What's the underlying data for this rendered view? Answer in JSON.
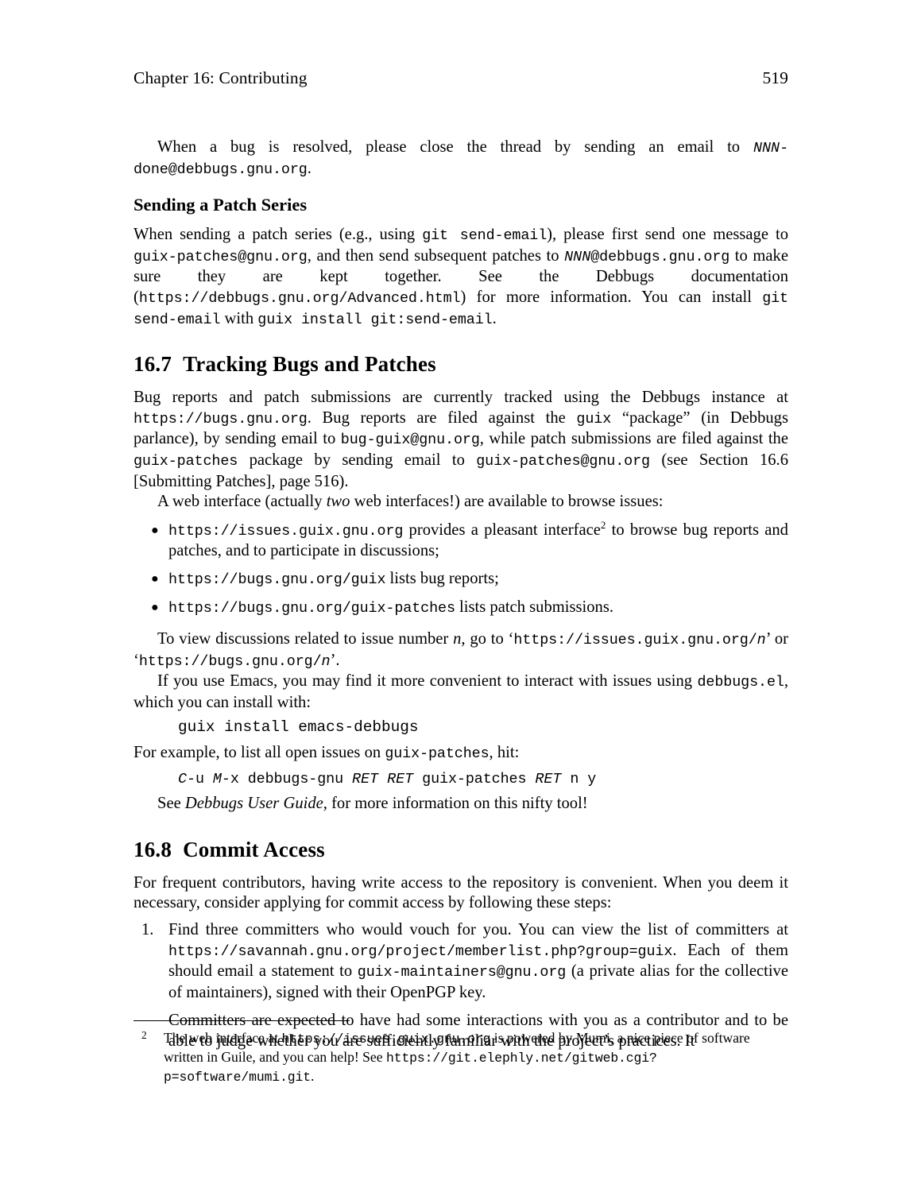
{
  "page": {
    "running_head": "Chapter 16:  Contributing",
    "page_number": "519"
  },
  "intro_paragraph": {
    "text_before": "When a bug is resolved, please close the thread by sending an email to ",
    "email_italic": "NNN",
    "email_rest": "-done@debbugs.gnu.org",
    "text_after": "."
  },
  "patch_series": {
    "heading": "Sending a Patch Series",
    "p1_a": "When sending a patch series (e.g., using ",
    "p1_code1": "git send-email",
    "p1_b": "), please first send one message to ",
    "p1_code2": "guix-patches@gnu.org",
    "p1_c": ", and then send subsequent patches to ",
    "p1_code3_italic": "NNN",
    "p1_code3_rest": "@debbugs.gnu.org",
    "p1_d": " to make sure they are kept together. See the Debbugs documentation (",
    "p1_url": "https://debbugs.gnu.org/Advanced.html",
    "p1_e": ") for more information. You can install ",
    "p1_code4": "git send-email",
    "p1_f": " with ",
    "p1_code5": "guix install git:send-email",
    "p1_g": "."
  },
  "section_167": {
    "number": "16.7",
    "title": "Tracking Bugs and Patches",
    "p1_a": "Bug reports and patch submissions are currently tracked using the Debbugs instance at ",
    "p1_url": "https://bugs.gnu.org",
    "p1_b": ". Bug reports are filed against the ",
    "p1_code1": "guix",
    "p1_c": " “package” (in Debbugs parlance), by sending email to ",
    "p1_code2": "bug-guix@gnu.org",
    "p1_d": ", while patch submissions are filed against the ",
    "p1_code3": "guix-patches",
    "p1_e": " package by sending email to ",
    "p1_code4": "guix-patches@gnu.org",
    "p1_f": " (see Section 16.6 [Submitting Patches], page 516).",
    "p2_a": "A web interface (actually ",
    "p2_italic": "two",
    "p2_b": " web interfaces!) are available to browse issues:",
    "bullets": [
      {
        "code": "https://issues.guix.gnu.org",
        "text_a": " provides a pleasant interface",
        "footnote_mark": "2",
        "text_b": " to browse bug reports and patches, and to participate in discussions;"
      },
      {
        "code": "https://bugs.gnu.org/guix",
        "text_a": " lists bug reports;",
        "footnote_mark": "",
        "text_b": ""
      },
      {
        "code": "https://bugs.gnu.org/guix-patches",
        "text_a": " lists patch submissions.",
        "footnote_mark": "",
        "text_b": ""
      }
    ],
    "p3_a": "To view discussions related to issue number ",
    "p3_italic_n": "n",
    "p3_b": ", go to ‘",
    "p3_url1": "https://issues.guix.gnu.org/",
    "p3_url1_n": "n",
    "p3_c": "’ or ‘",
    "p3_url2": "https://bugs.gnu.org/",
    "p3_url2_n": "n",
    "p3_d": "’.",
    "p4_a": "If you use Emacs, you may find it more convenient to interact with issues using ",
    "p4_code": "debbugs.el",
    "p4_b": ", which you can install with:",
    "code_install": "guix install emacs-debbugs",
    "p5_a": "For example, to list all open issues on ",
    "p5_code": "guix-patches",
    "p5_b": ", hit:",
    "keybinding": {
      "k1": "C",
      "k1_rest": "-u ",
      "k2": "M",
      "k2_rest": "-x debbugs-gnu ",
      "k3": "RET RET",
      "k3_rest": " guix-patches ",
      "k4": "RET",
      "k4_rest": " n y"
    },
    "p6_a": "See ",
    "p6_italic": "Debbugs User Guide",
    "p6_b": ", for more information on this nifty tool!"
  },
  "section_168": {
    "number": "16.8",
    "title": "Commit Access",
    "p1": "For frequent contributors, having write access to the repository is convenient.  When you deem it necessary, consider applying for commit access by following these steps:",
    "steps": [
      {
        "num": "1.",
        "p1_a": "Find three committers who would vouch for you. You can view the list of committers at ",
        "p1_url": "https://savannah.gnu.org/project/memberlist.php?group=guix",
        "p1_b": ". Each of them should email a statement to ",
        "p1_code": "guix-maintainers@gnu.org",
        "p1_c": " (a private alias for the collective of maintainers), signed with their OpenPGP key.",
        "p2": "Committers are expected to have had some interactions with you as a contributor and to be able to judge whether you are sufficiently familiar with the project’s practices. It"
      }
    ]
  },
  "footnote": {
    "mark": "2",
    "text_a": "The web interface at ",
    "url1": "https://issues.guix.gnu.org",
    "text_b": " is powered by Mumi, a nice piece of software written in Guile, and you can help! See ",
    "url2": "https://git.elephly.net/gitweb.cgi?p=software/mumi.git",
    "text_c": "."
  }
}
